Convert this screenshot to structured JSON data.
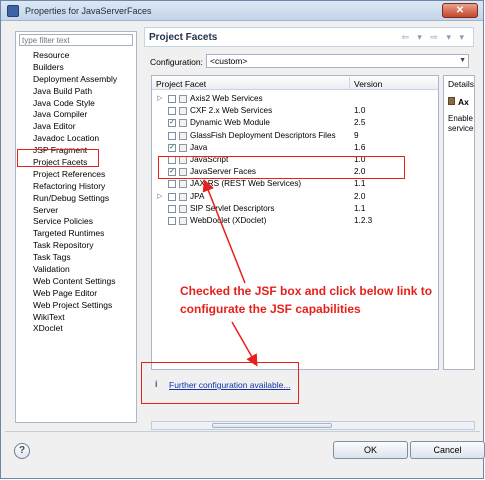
{
  "window": {
    "title": "Properties for JavaServerFaces",
    "close_glyph": "✕"
  },
  "sidebar": {
    "filter_placeholder": "type filter text",
    "items": [
      "Resource",
      "Builders",
      "Deployment Assembly",
      "Java Build Path",
      "Java Code Style",
      "Java Compiler",
      "Java Editor",
      "Javadoc Location",
      "JSP Fragment",
      "Project Facets",
      "Project References",
      "Refactoring History",
      "Run/Debug Settings",
      "Server",
      "Service Policies",
      "Targeted Runtimes",
      "Task Repository",
      "Task Tags",
      "Validation",
      "Web Content Settings",
      "Web Page Editor",
      "Web Project Settings",
      "WikiText",
      "XDoclet"
    ],
    "selected": "Project Facets"
  },
  "main": {
    "title": "Project Facets",
    "nav_arrows": "⇦ ▾ ⇨ ▾ ▾",
    "configuration_label": "Configuration:",
    "configuration_value": "<custom>",
    "table": {
      "col_facet": "Project Facet",
      "col_version": "Version",
      "rows": [
        {
          "name": "Axis2 Web Services",
          "version": "",
          "checked": false,
          "expandable": true
        },
        {
          "name": "CXF 2.x Web Services",
          "version": "1.0",
          "checked": false,
          "expandable": false
        },
        {
          "name": "Dynamic Web Module",
          "version": "2.5",
          "checked": true,
          "expandable": false
        },
        {
          "name": "GlassFish Deployment Descriptors Files",
          "version": "9",
          "checked": false,
          "expandable": false
        },
        {
          "name": "Java",
          "version": "1.6",
          "checked": true,
          "expandable": false
        },
        {
          "name": "JavaScript",
          "version": "1.0",
          "checked": false,
          "expandable": false
        },
        {
          "name": "JavaServer Faces",
          "version": "2.0",
          "checked": true,
          "expandable": false
        },
        {
          "name": "JAX-RS (REST Web Services)",
          "version": "1.1",
          "checked": false,
          "expandable": false
        },
        {
          "name": "JPA",
          "version": "2.0",
          "checked": false,
          "expandable": true
        },
        {
          "name": "SIP Servlet Descriptors",
          "version": "1.1",
          "checked": false,
          "expandable": false
        },
        {
          "name": "WebDoclet (XDoclet)",
          "version": "1.2.3",
          "checked": false,
          "expandable": false
        }
      ]
    },
    "details": {
      "header": "Details",
      "item": "Ax",
      "text": "Enable service"
    },
    "info_glyph": "i",
    "further_config_link": "Further configuration available..."
  },
  "footer": {
    "help_glyph": "?",
    "ok_label": "OK",
    "cancel_label": "Cancel"
  },
  "annotation": {
    "callout_text": "Checked the JSF box and click below link to configurate the JSF capabilities",
    "color": "#e8201b"
  }
}
